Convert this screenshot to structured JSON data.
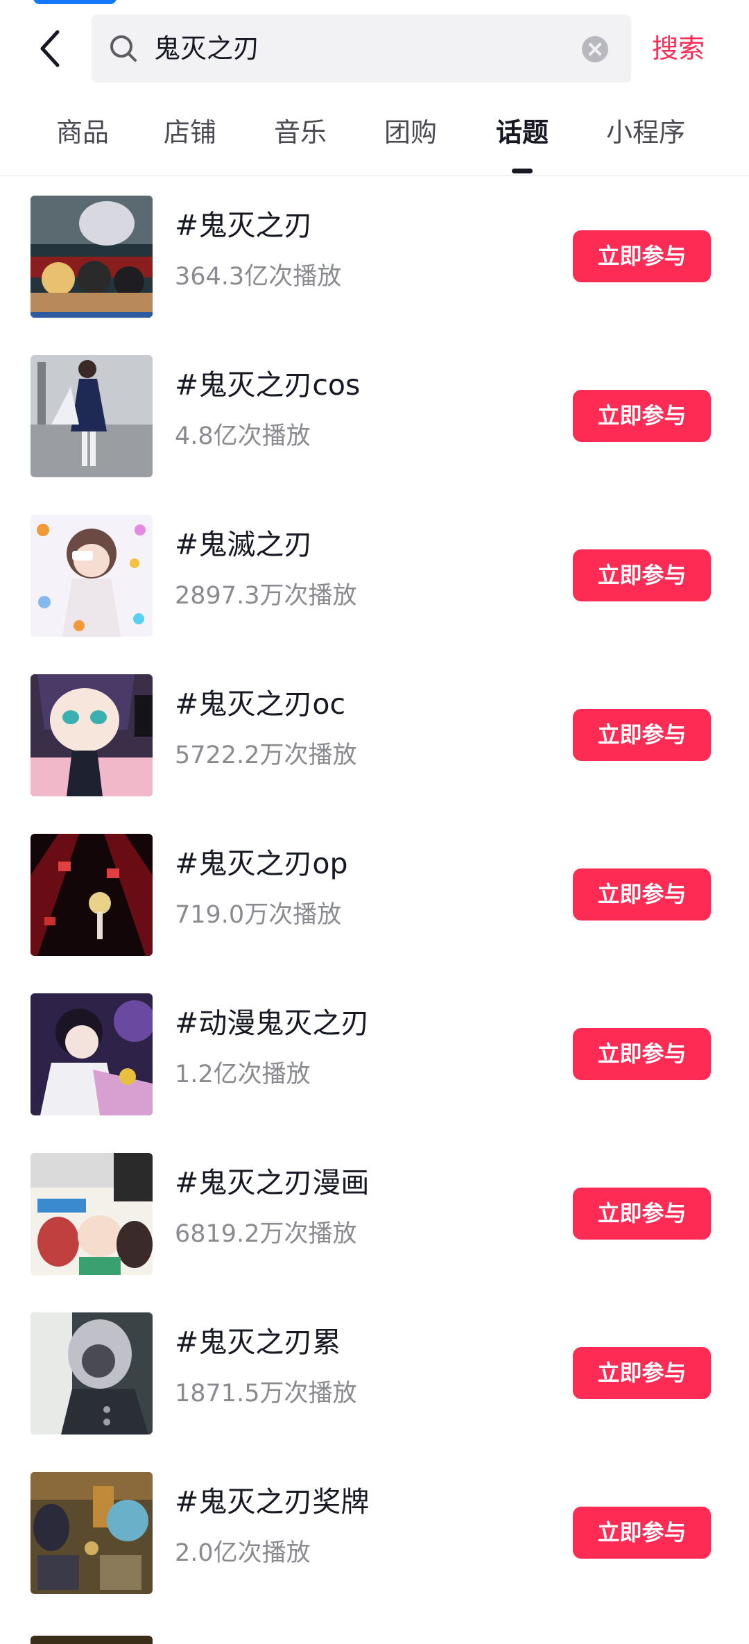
{
  "search": {
    "query": "鬼灭之刃",
    "search_label": "搜索"
  },
  "tabs": [
    {
      "label": "商品"
    },
    {
      "label": "店铺"
    },
    {
      "label": "音乐"
    },
    {
      "label": "团购"
    },
    {
      "label": "话题",
      "active": true
    },
    {
      "label": "小程序"
    }
  ],
  "topics": [
    {
      "title": "#鬼灭之刃",
      "views": "364.3亿次播放",
      "join_label": "立即参与"
    },
    {
      "title": "#鬼灭之刃cos",
      "views": "4.8亿次播放",
      "join_label": "立即参与"
    },
    {
      "title": "#鬼滅之刃",
      "views": "2897.3万次播放",
      "join_label": "立即参与"
    },
    {
      "title": "#鬼灭之刃oc",
      "views": "5722.2万次播放",
      "join_label": "立即参与"
    },
    {
      "title": "#鬼灭之刃op",
      "views": "719.0万次播放",
      "join_label": "立即参与"
    },
    {
      "title": "#动漫鬼灭之刃",
      "views": "1.2亿次播放",
      "join_label": "立即参与"
    },
    {
      "title": "#鬼灭之刃漫画",
      "views": "6819.2万次播放",
      "join_label": "立即参与"
    },
    {
      "title": "#鬼灭之刃累",
      "views": "1871.5万次播放",
      "join_label": "立即参与"
    },
    {
      "title": "#鬼灭之刃奖牌",
      "views": "2.0亿次播放",
      "join_label": "立即参与"
    }
  ],
  "colors": {
    "accent": "#fe2c55",
    "text_primary": "#161823",
    "text_secondary": "#8a8b91",
    "search_bg": "#f2f2f4"
  },
  "icons": {
    "back": "chevron-left-icon",
    "search": "search-icon",
    "clear": "clear-icon"
  }
}
